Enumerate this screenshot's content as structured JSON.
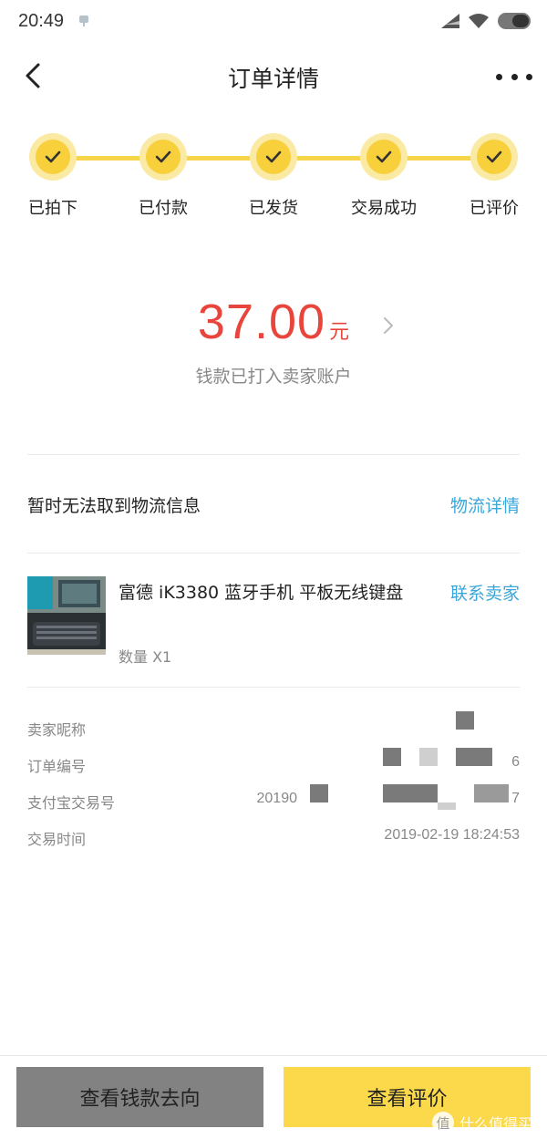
{
  "status_bar": {
    "time": "20:49"
  },
  "nav": {
    "title": "订单详情",
    "back_icon": "chevron-left-icon",
    "more_icon": "more-dots-icon"
  },
  "progress": {
    "steps": [
      {
        "label": "已拍下",
        "done": true
      },
      {
        "label": "已付款",
        "done": true
      },
      {
        "label": "已发货",
        "done": true
      },
      {
        "label": "交易成功",
        "done": true
      },
      {
        "label": "已评价",
        "done": true
      }
    ],
    "color": "#f7d03b"
  },
  "amount": {
    "value": "37.00",
    "unit": "元",
    "note": "钱款已打入卖家账户",
    "color": "#e8463c"
  },
  "logistics": {
    "text": "暂时无法取到物流信息",
    "link": "物流详情"
  },
  "product": {
    "title": "富德 iK3380 蓝牙手机 平板无线键盘",
    "quantity": "数量 X1",
    "contact": "联系卖家"
  },
  "info": {
    "seller_label": "卖家昵称",
    "order_label": "订单编号",
    "order_value_tail": "6",
    "alipay_label": "支付宝交易号",
    "alipay_value_head": "20190",
    "alipay_value_tail": "7",
    "time_label": "交易时间",
    "time_value": "2019-02-19 18:24:53"
  },
  "buttons": {
    "money_flow": "查看钱款去向",
    "view_review": "查看评价"
  },
  "watermark": {
    "icon_char": "值",
    "text": "什么值得买"
  },
  "colors": {
    "link": "#3ba6d9",
    "primary_button": "#fbd94a",
    "secondary_button": "#828282"
  }
}
